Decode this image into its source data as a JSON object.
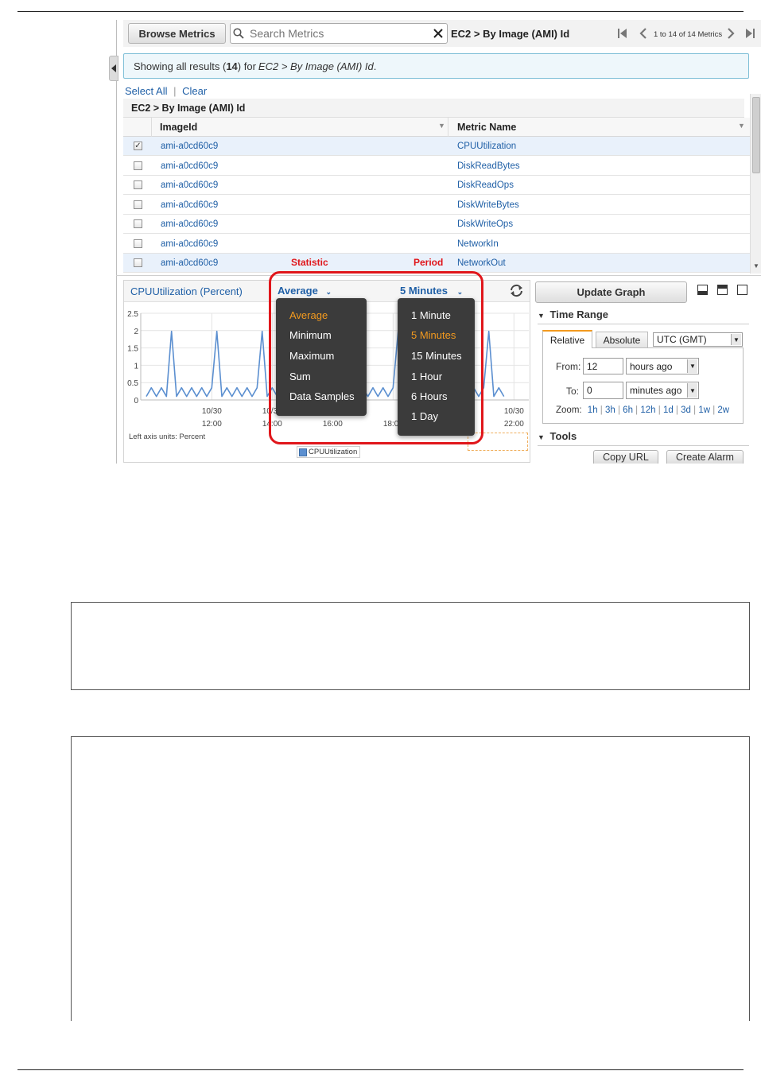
{
  "toolbar": {
    "browse_label": "Browse Metrics",
    "search_placeholder": "Search Metrics",
    "breadcrumb": "EC2 > By Image (AMI) Id",
    "pagination": "1 to 14 of 14 Metrics"
  },
  "results": {
    "prefix": "Showing all results (",
    "count": "14",
    "middle": ") for ",
    "target": "EC2 > By Image (AMI) Id",
    "suffix": "."
  },
  "selection": {
    "select_all": "Select All",
    "separator": "|",
    "clear": "Clear"
  },
  "table": {
    "group_title": "EC2 > By Image (AMI) Id",
    "col_image": "ImageId",
    "col_metric": "Metric Name",
    "rows": [
      {
        "image": "ami-a0cd60c9",
        "metric": "CPUUtilization",
        "checked": true
      },
      {
        "image": "ami-a0cd60c9",
        "metric": "DiskReadBytes",
        "checked": false
      },
      {
        "image": "ami-a0cd60c9",
        "metric": "DiskReadOps",
        "checked": false
      },
      {
        "image": "ami-a0cd60c9",
        "metric": "DiskWriteBytes",
        "checked": false
      },
      {
        "image": "ami-a0cd60c9",
        "metric": "DiskWriteOps",
        "checked": false
      },
      {
        "image": "ami-a0cd60c9",
        "metric": "NetworkIn",
        "checked": false
      },
      {
        "image": "ami-a0cd60c9",
        "metric": "NetworkOut",
        "checked": false
      }
    ]
  },
  "annotations": {
    "statistic": "Statistic",
    "period": "Period"
  },
  "graph": {
    "title": "CPUUtilization (Percent)",
    "statistic_value": "Average",
    "period_value": "5 Minutes",
    "axis_units": "Left axis units:  Percent",
    "legend": "CPUUtilization",
    "series_color": "#5b8fd0"
  },
  "statistic_menu": {
    "items": [
      "Average",
      "Minimum",
      "Maximum",
      "Sum",
      "Data Samples"
    ],
    "active": "Average"
  },
  "period_menu": {
    "items": [
      "1 Minute",
      "5 Minutes",
      "15 Minutes",
      "1 Hour",
      "6 Hours",
      "1 Day"
    ],
    "active": "5 Minutes"
  },
  "chart_data": {
    "type": "line",
    "title": "CPUUtilization (Percent)",
    "ylabel": "Percent",
    "ylim": [
      0,
      2.5
    ],
    "yticks": [
      "2.5",
      "2",
      "1.5",
      "1",
      "0.5",
      "0"
    ],
    "xticks": [
      {
        "date": "10/30",
        "time": "12:00"
      },
      {
        "date": "10/30",
        "time": "14:00"
      },
      {
        "date": "",
        "time": "16:00"
      },
      {
        "date": "",
        "time": "18:00"
      },
      {
        "date": "10/30",
        "time": "22:00"
      }
    ],
    "series": [
      {
        "name": "CPUUtilization",
        "x": [
          "09:50",
          "10:00",
          "10:10",
          "10:20",
          "10:30",
          "10:40",
          "10:50",
          "11:00",
          "11:10",
          "11:20",
          "11:30",
          "11:40",
          "11:50",
          "12:00",
          "12:10",
          "12:20",
          "12:30",
          "12:40",
          "12:50",
          "13:00",
          "13:10",
          "13:20",
          "13:30",
          "13:40",
          "13:50",
          "14:00",
          "14:10",
          "14:20",
          "14:30",
          "14:40",
          "14:50",
          "15:00",
          "15:10",
          "15:20",
          "15:30",
          "15:40",
          "15:50",
          "16:00",
          "16:10",
          "16:20",
          "16:30",
          "16:40",
          "16:50",
          "17:00",
          "17:10",
          "17:20",
          "17:30",
          "17:40",
          "17:50",
          "18:00",
          "18:10",
          "18:20",
          "18:30",
          "18:40",
          "18:50",
          "19:00",
          "19:10",
          "19:20",
          "19:30",
          "19:40",
          "19:50",
          "20:00",
          "20:10",
          "20:20",
          "20:30",
          "20:40",
          "20:50",
          "21:00",
          "21:10",
          "21:20",
          "21:30",
          "21:40"
        ],
        "values": [
          0.1,
          0.35,
          0.1,
          0.35,
          0.1,
          1.98,
          0.1,
          0.35,
          0.1,
          0.35,
          0.1,
          0.35,
          0.1,
          0.35,
          1.98,
          0.1,
          0.35,
          0.1,
          0.35,
          0.1,
          0.35,
          0.1,
          0.35,
          1.98,
          0.1,
          0.35,
          0.1,
          0.35,
          0.1,
          0.35,
          0.1,
          0.35,
          1.98,
          0.1,
          0.35,
          0.1,
          0.35,
          0.1,
          0.35,
          0.1,
          0.35,
          1.98,
          0.1,
          0.35,
          0.1,
          0.35,
          0.1,
          0.35,
          0.1,
          0.35,
          1.98,
          0.1,
          0.35,
          0.1,
          0.35,
          0.1,
          0.35,
          0.1,
          0.35,
          1.98,
          0.1,
          0.35,
          0.1,
          0.35,
          0.1,
          0.35,
          0.1,
          0.35,
          1.98,
          0.1,
          0.35,
          0.1
        ]
      }
    ],
    "grid": true,
    "legend": "bottom"
  },
  "panel": {
    "update_label": "Update Graph",
    "time_range_label": "Time Range",
    "tab_relative": "Relative",
    "tab_absolute": "Absolute",
    "timezone": "UTC (GMT)",
    "from_label": "From:",
    "from_value": "12",
    "from_unit": "hours ago",
    "to_label": "To:",
    "to_value": "0",
    "to_unit": "minutes ago",
    "zoom_label": "Zoom:",
    "zoom_options": [
      "1h",
      "3h",
      "6h",
      "12h",
      "1d",
      "3d",
      "1w",
      "2w"
    ],
    "tools_label": "Tools",
    "copy_url": "Copy URL",
    "create_alarm": "Create Alarm"
  },
  "colors": {
    "annotation_red": "#e0161b",
    "active_orange": "#f39a1f",
    "link_blue": "#1f5fa6"
  }
}
